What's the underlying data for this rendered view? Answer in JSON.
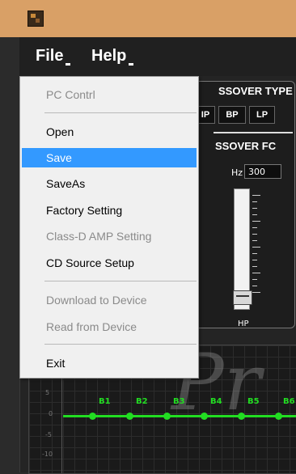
{
  "menubar": {
    "file": "File",
    "help": "Help"
  },
  "file_menu": {
    "items": [
      {
        "label": "PC Contrl",
        "state": "disabled"
      },
      {
        "label": "Open",
        "state": "enabled"
      },
      {
        "label": "Save",
        "state": "selected"
      },
      {
        "label": "SaveAs",
        "state": "enabled"
      },
      {
        "label": "Factory Setting",
        "state": "enabled"
      },
      {
        "label": "Class-D AMP Setting",
        "state": "disabled"
      },
      {
        "label": "CD Source Setup",
        "state": "enabled"
      },
      {
        "label": "Download to Device",
        "state": "disabled"
      },
      {
        "label": "Read from Device",
        "state": "disabled"
      },
      {
        "label": "Exit",
        "state": "enabled"
      }
    ]
  },
  "crossover": {
    "type_label": "SSOVER TYPE",
    "buttons": [
      "IP",
      "BP",
      "LP"
    ],
    "fc_label": "SSOVER FC",
    "hz_label": "Hz",
    "hz_value": "300",
    "slider_label": "HP"
  },
  "eq": {
    "watermark": "Pr",
    "ticks": [
      "5",
      "0",
      "-5",
      "-10"
    ],
    "bands": [
      "B1",
      "B2",
      "B3",
      "B4",
      "B5",
      "B6"
    ]
  },
  "colors": {
    "titlebar": "#d9a066",
    "menubar": "#202020",
    "menu_selected": "#3399ff",
    "eq_green": "#22dd22"
  }
}
